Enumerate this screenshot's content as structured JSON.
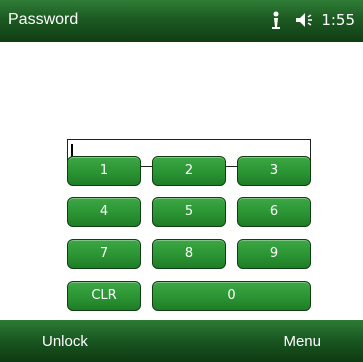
{
  "header": {
    "title": "Password",
    "time": "1:55",
    "icons": [
      "connectivity-icon",
      "speaker-icon"
    ]
  },
  "password_field": {
    "value": ""
  },
  "keypad": {
    "keys": [
      "1",
      "2",
      "3",
      "4",
      "5",
      "6",
      "7",
      "8",
      "9",
      "CLR",
      "0"
    ]
  },
  "softkeys": {
    "left": "Unlock",
    "right": "Menu"
  },
  "colors": {
    "bar_green": "#1d5a22",
    "key_green": "#2c9635",
    "background": "#ffffff"
  }
}
